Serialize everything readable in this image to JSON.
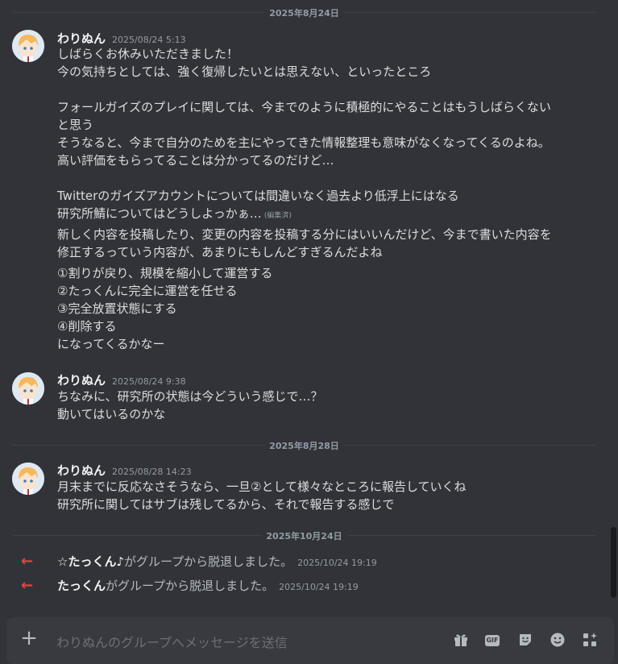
{
  "dates": [
    "2025年8月24日",
    "2025年8月28日",
    "2025年10月24日"
  ],
  "messages": [
    {
      "author": "わりぬん",
      "time": "2025/08/24 5:13",
      "lines": [
        "しばらくお休みいただきました！",
        "今の気持ちとしては、強く復帰したいとは思えない、といったところ",
        "フォールガイズのプレイに関しては、今までのように積極的にやることはもうしばらくない",
        "と思う",
        "そうなると、今まで自分のためを主にやってきた情報整理も意味がなくなってくるのよね。",
        "高い評価をもらってることは分かってるのだけど…",
        "Twitterのガイズアカウントについては間違いなく過去より低浮上にはなる",
        "研究所鯖についてはどうしよっかぁ…",
        "新しく内容を投稿したり、変更の内容を投稿する分にはいいんだけど、今まで書いた内容を",
        "修正するっていう内容が、あまりにもしんどすぎるんだよね",
        "①割りが戻り、規模を縮小して運営する",
        "②たっくんに完全に運営を任せる",
        "③完全放置状態にする",
        "④削除する",
        "になってくるかなー"
      ],
      "edited_label": "(編集済)"
    },
    {
      "author": "わりぬん",
      "time": "2025/08/24 9:38",
      "lines": [
        "ちなみに、研究所の状態は今どういう感じで…？",
        "動いてはいるのかな"
      ]
    },
    {
      "author": "わりぬん",
      "time": "2025/08/28 14:23",
      "lines": [
        "月末までに反応なさそうなら、一旦②として様々なところに報告していくね",
        "研究所に関してはサブは残してるから、それで報告する感じで"
      ]
    }
  ],
  "system": [
    {
      "who": "☆たっくん♪",
      "text": "がグループから脱退しました。",
      "time": "2025/10/24 19:19"
    },
    {
      "who": "たっくん",
      "text": "がグループから脱退しました。",
      "time": "2025/10/24 19:19"
    }
  ],
  "composer": {
    "placeholder": "わりぬんのグループへメッセージを送信",
    "gif_label": "GIF"
  },
  "icons": [
    "plus-icon",
    "gift-icon",
    "gif-icon",
    "sticker-icon",
    "emoji-icon",
    "apps-icon",
    "leave-arrow-icon"
  ],
  "colors": {
    "background": "#313338",
    "leave_arrow": "#f23f42"
  }
}
